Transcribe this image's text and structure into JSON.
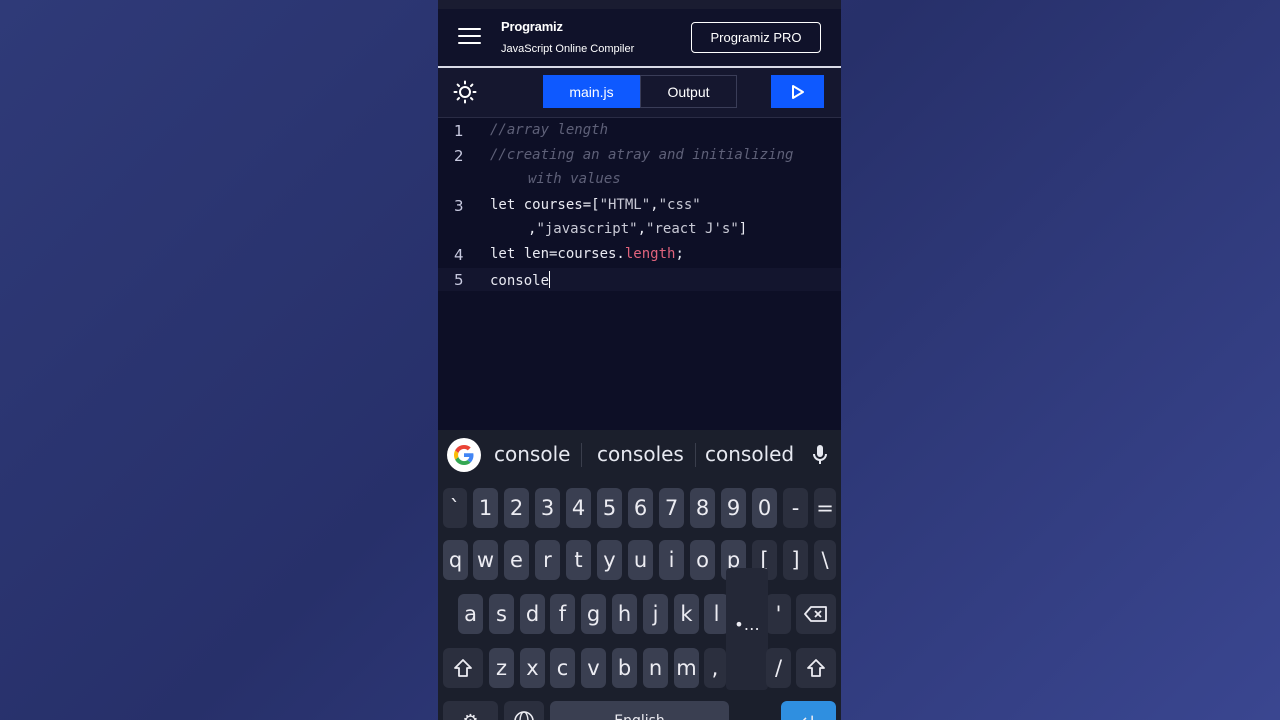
{
  "header": {
    "logo": "Programiz",
    "subtitle": "JavaScript Online Compiler",
    "pro_button": "Programiz PRO"
  },
  "toolbar": {
    "tab_main": "main.js",
    "tab_output": "Output"
  },
  "editor": {
    "line_numbers": [
      "1",
      "2",
      "3",
      "4",
      "5"
    ],
    "line1": "//array length",
    "line2a": "//creating an atray and initializing",
    "line2b": "with values",
    "line3a_kw": "let courses=[",
    "line3a_s1": "\"HTML\"",
    "line3a_c1": ",",
    "line3a_s2": "\"css\"",
    "line3b_c1": ",",
    "line3b_s1": "\"javascript\"",
    "line3b_c2": ",",
    "line3b_s2": "\"react J's\"",
    "line3b_end": "]",
    "line4a": "let len=courses.",
    "line4b": "length",
    "line4c": ";",
    "line5": "console"
  },
  "keyboard": {
    "suggestions": [
      "console",
      "consoles",
      "consoled"
    ],
    "row1": [
      "`",
      "1",
      "2",
      "3",
      "4",
      "5",
      "6",
      "7",
      "8",
      "9",
      "0",
      "-",
      "="
    ],
    "row2": [
      "q",
      "w",
      "e",
      "r",
      "t",
      "y",
      "u",
      "i",
      "o",
      "p",
      "[",
      "]",
      "\\"
    ],
    "row3": [
      "a",
      "s",
      "d",
      "f",
      "g",
      "h",
      "j",
      "k",
      "l",
      "'"
    ],
    "row4": [
      "z",
      "x",
      "c",
      "v",
      "b",
      "n",
      "m",
      ",",
      "/"
    ],
    "popup": "•…",
    "space_label": "English"
  },
  "colors": {
    "accent": "#0e59ff",
    "background": "#0d0f26",
    "comment": "#5e6078",
    "property": "#e0637c"
  },
  "icons": [
    "menu-icon",
    "sun-icon",
    "play-icon",
    "google-icon",
    "mic-icon",
    "backspace-icon",
    "shift-icon",
    "settings-icon",
    "globe-icon",
    "enter-icon"
  ]
}
